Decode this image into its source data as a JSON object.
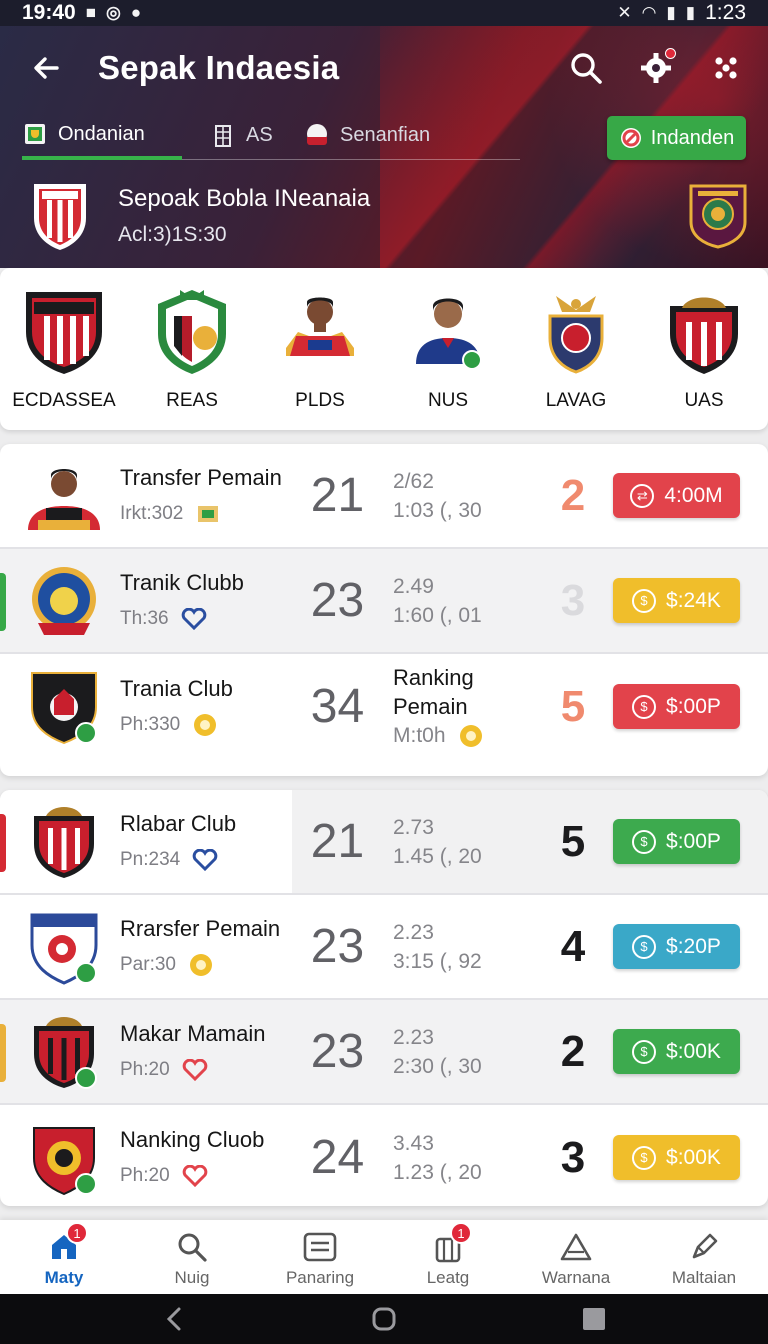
{
  "status_bar": {
    "time": "19:40",
    "right_time": "1:23"
  },
  "header": {
    "title": "Sepak Indaesia",
    "tabs": [
      {
        "label": "Ondanian",
        "active": true
      },
      {
        "label": "AS",
        "active": false
      },
      {
        "label": "Senanfian",
        "active": false
      }
    ],
    "cta_label": "Indanden",
    "match_title": "Sepoak Bobla INeanaia",
    "match_subtitle": "Acl:3)1S:30"
  },
  "clubs": [
    {
      "name": "ECDASSEA"
    },
    {
      "name": "REAS"
    },
    {
      "name": "PLDS"
    },
    {
      "name": "NUS"
    },
    {
      "name": "LAVAG"
    },
    {
      "name": "UAS"
    }
  ],
  "list_one": [
    {
      "title": "Transfer Pemain",
      "meta": "Irkt:302",
      "big": "21",
      "stat1": "2/62",
      "stat2": "1:03 (, 30",
      "rank": "2",
      "rank_color": "#f08a6e",
      "btn_label": "4:00M",
      "btn_color": "#e2434b"
    },
    {
      "title": "Tranik Clubb",
      "meta": "Th:36",
      "big": "23",
      "stat1": "2.49",
      "stat2": "1:60 (, 01",
      "rank": "3",
      "rank_color": "#dadadd",
      "btn_label": "$:24K",
      "btn_color": "#f0be2b"
    },
    {
      "title": "Trania Club",
      "meta": "Ph:330",
      "big": "34",
      "stat1": "Ranking Pemain",
      "stat2": "M:t0h",
      "rank": "5",
      "rank_color": "#f08a6e",
      "btn_label": "$:00P",
      "btn_color": "#e2434b"
    }
  ],
  "list_two": [
    {
      "title": "Rlabar Club",
      "meta": "Pn:234",
      "big": "21",
      "stat1": "2.73",
      "stat2": "1.45 (, 20",
      "rank": "5",
      "rank_color": "#1b1b1d",
      "btn_label": "$:00P",
      "btn_color": "#3daa4e"
    },
    {
      "title": "Rrarsfer Pemain",
      "meta": "Par:30",
      "big": "23",
      "stat1": "2.23",
      "stat2": "3:15 (, 92",
      "rank": "4",
      "rank_color": "#1b1b1d",
      "btn_label": "$:20P",
      "btn_color": "#3aa8c8"
    },
    {
      "title": "Makar Mamain",
      "meta": "Ph:20",
      "big": "23",
      "stat1": "2.23",
      "stat2": "2:30 (, 30",
      "rank": "2",
      "rank_color": "#1b1b1d",
      "btn_label": "$:00K",
      "btn_color": "#3daa4e"
    },
    {
      "title": "Nanking Cluob",
      "meta": "Ph:20",
      "big": "24",
      "stat1": "3.43",
      "stat2": "1.23 (, 20",
      "rank": "3",
      "rank_color": "#1b1b1d",
      "btn_label": "$:00K",
      "btn_color": "#f0be2b"
    }
  ],
  "bottom_nav": [
    {
      "label": "Maty",
      "badge": "1"
    },
    {
      "label": "Nuig"
    },
    {
      "label": "Panaring"
    },
    {
      "label": "Leatg",
      "badge": "1"
    },
    {
      "label": "Warnana"
    },
    {
      "label": "Maltaian"
    }
  ],
  "colors": {
    "accent_green": "#37a847",
    "header_red": "#b51c2a",
    "nav_active": "#1565c0"
  }
}
